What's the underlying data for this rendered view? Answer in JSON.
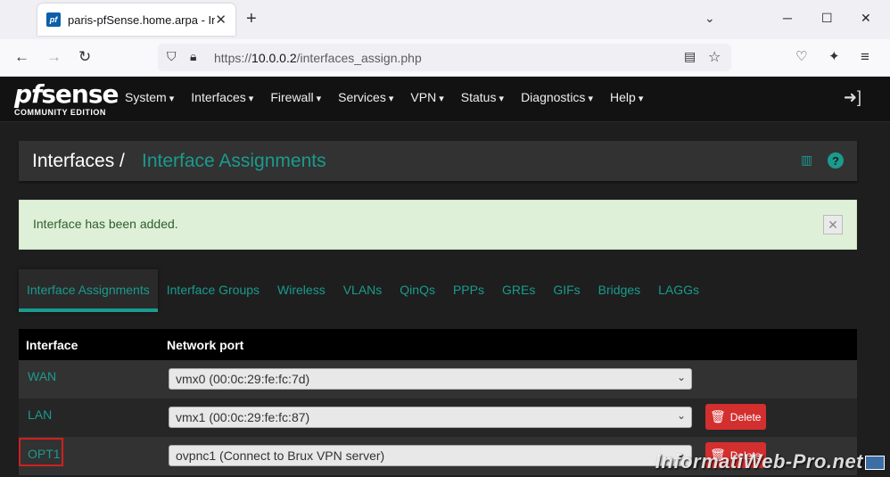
{
  "browser": {
    "tab_title": "paris-pfSense.home.arpa - Interfaces",
    "favicon_label": "pf",
    "url_prefix": "https://",
    "url_host": "10.0.0.2",
    "url_path": "/interfaces_assign.php"
  },
  "header": {
    "logo_prefix": "pf",
    "logo_main": "sense",
    "logo_sub": "COMMUNITY EDITION",
    "menu": [
      "System",
      "Interfaces",
      "Firewall",
      "Services",
      "VPN",
      "Status",
      "Diagnostics",
      "Help"
    ]
  },
  "breadcrumb": {
    "root": "Interfaces /",
    "current": "Interface Assignments"
  },
  "alert": {
    "message": "Interface has been added."
  },
  "tabs": [
    "Interface Assignments",
    "Interface Groups",
    "Wireless",
    "VLANs",
    "QinQs",
    "PPPs",
    "GREs",
    "GIFs",
    "Bridges",
    "LAGGs"
  ],
  "table": {
    "headers": {
      "interface": "Interface",
      "port": "Network port"
    },
    "rows": [
      {
        "name": "WAN",
        "port": "vmx0 (00:0c:29:fe:fc:7d)",
        "delete": ""
      },
      {
        "name": "LAN",
        "port": "vmx1 (00:0c:29:fe:fc:87)",
        "delete": "Delete"
      },
      {
        "name": "OPT1",
        "port": "ovpnc1 (Connect to Brux VPN server)",
        "delete": "Delete"
      }
    ]
  },
  "watermark": "InformatiWeb-Pro.net",
  "colors": {
    "accent": "#1a9b8d",
    "danger": "#d32f2f",
    "header_bg": "#121212"
  }
}
